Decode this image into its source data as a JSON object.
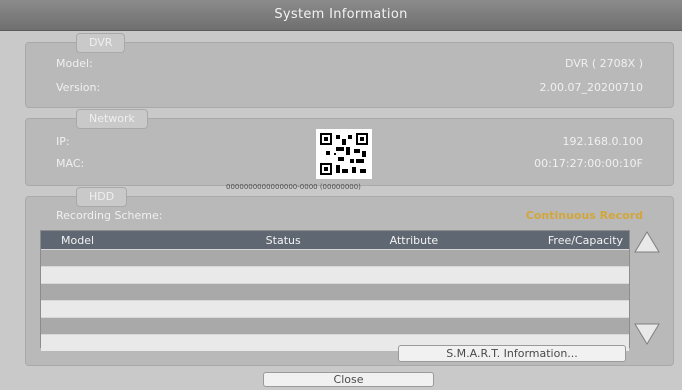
{
  "window": {
    "title": "System Information"
  },
  "dvr": {
    "legend": "DVR",
    "model_label": "Model:",
    "model_value": "DVR ( 2708X )",
    "version_label": "Version:",
    "version_value": "2.00.07_20200710"
  },
  "network": {
    "legend": "Network",
    "ip_label": "IP:",
    "ip_value": "192.168.0.100",
    "mac_label": "MAC:",
    "mac_value": "00:17:27:00:00:10F",
    "qr_caption": "0000000000000000-0000 (00000000)"
  },
  "hdd": {
    "legend": "HDD",
    "recording_scheme_label": "Recording Scheme:",
    "recording_scheme_value": "Continuous Record",
    "columns": [
      "Model",
      "Status",
      "Attribute",
      "Free/Capacity"
    ],
    "smart_button": "S.M.A.R.T. Information..."
  },
  "close_button": "Close",
  "colors": {
    "accent": "#d2a63a",
    "header": "#5f6872"
  }
}
